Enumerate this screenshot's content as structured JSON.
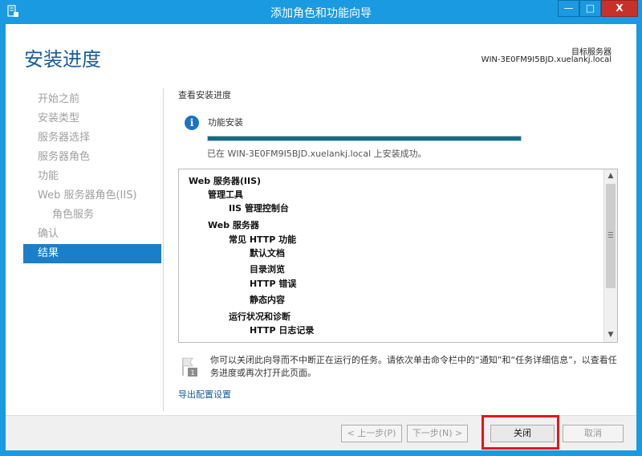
{
  "window": {
    "title": "添加角色和功能向导",
    "min_label": "—",
    "max_label": "□",
    "close_label": "X"
  },
  "header": {
    "page_title": "安装进度",
    "target_label": "目标服务器",
    "target_server": "WIN-3E0FM9I5BJD.xuelankj.local"
  },
  "nav": {
    "items": [
      {
        "label": "开始之前"
      },
      {
        "label": "安装类型"
      },
      {
        "label": "服务器选择"
      },
      {
        "label": "服务器角色"
      },
      {
        "label": "功能"
      },
      {
        "label": "Web 服务器角色(IIS)"
      },
      {
        "label": "角色服务"
      },
      {
        "label": "确认"
      },
      {
        "label": "结果"
      }
    ]
  },
  "main": {
    "section_title": "查看安装进度",
    "feature_label": "功能安装",
    "progress_percent": 100,
    "status_text": "已在 WIN-3E0FM9I5BJD.xuelankj.local 上安装成功。",
    "results": [
      {
        "label": "Web 服务器(IIS)",
        "level": 0
      },
      {
        "label": "管理工具",
        "level": 1
      },
      {
        "label": "IIS 管理控制台",
        "level": 2
      },
      {
        "label": "Web 服务器",
        "level": 1
      },
      {
        "label": "常见 HTTP 功能",
        "level": 2
      },
      {
        "label": "默认文档",
        "level": 3
      },
      {
        "label": "目录浏览",
        "level": 3
      },
      {
        "label": "HTTP 错误",
        "level": 3
      },
      {
        "label": "静态内容",
        "level": 3
      },
      {
        "label": "运行状况和诊断",
        "level": 2
      },
      {
        "label": "HTTP 日志记录",
        "level": 3
      }
    ],
    "notice_text": "你可以关闭此向导而不中断正在运行的任务。请依次单击命令栏中的“通知”和“任务详细信息”，以查看任务进度或再次打开此页面。",
    "export_link": "导出配置设置"
  },
  "footer": {
    "prev_label": "< 上一步(P)",
    "next_label": "下一步(N) >",
    "close_label": "关闭",
    "cancel_label": "取消"
  },
  "colors": {
    "title_bar": "#1a9ae0",
    "accent": "#1a7fc8",
    "progress": "#0e6e8a",
    "highlight": "#e8141c"
  }
}
